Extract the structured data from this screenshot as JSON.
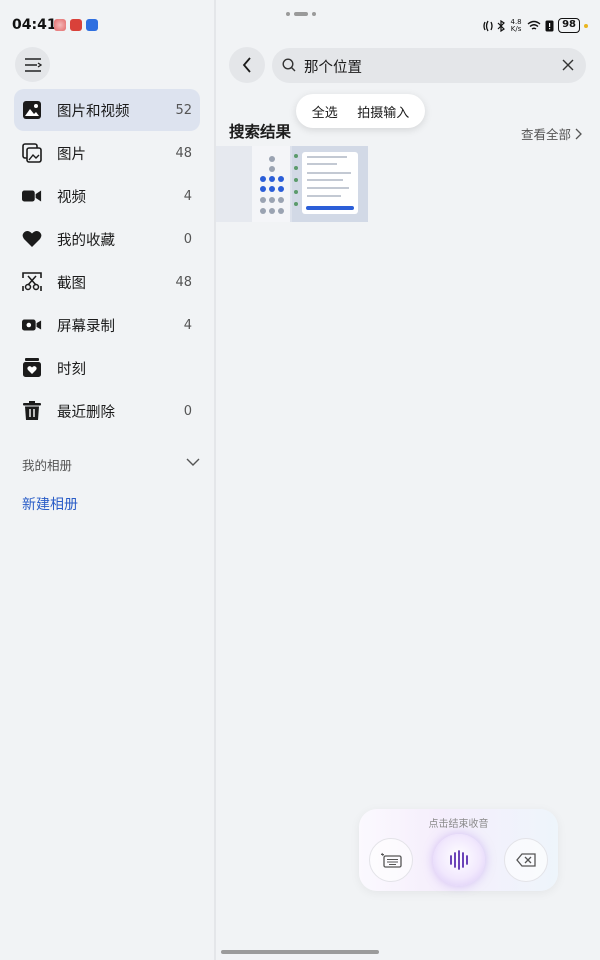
{
  "status_bar": {
    "time": "04:41",
    "network_speed": "4.8\nK/s",
    "battery": "98",
    "icons": [
      "nfc-icon",
      "bluetooth-icon",
      "network-speed-icon",
      "wifi-icon",
      "alert-icon",
      "battery-icon"
    ]
  },
  "sidebar": {
    "items": [
      {
        "label": "图片和视频",
        "count": "52",
        "icon": "photo-video-icon",
        "active": true
      },
      {
        "label": "图片",
        "count": "48",
        "icon": "images-icon"
      },
      {
        "label": "视频",
        "count": "4",
        "icon": "video-icon"
      },
      {
        "label": "我的收藏",
        "count": "0",
        "icon": "heart-icon"
      },
      {
        "label": "截图",
        "count": "48",
        "icon": "screenshot-icon"
      },
      {
        "label": "屏幕录制",
        "count": "4",
        "icon": "screen-record-icon"
      },
      {
        "label": "时刻",
        "count": "",
        "icon": "moments-icon"
      },
      {
        "label": "最近删除",
        "count": "0",
        "icon": "trash-icon"
      }
    ],
    "albums_header": "我的相册",
    "new_album": "新建相册"
  },
  "search": {
    "query": "那个位置"
  },
  "popup": {
    "select_all": "全选",
    "camera_input": "拍摄输入"
  },
  "results": {
    "title": "搜索结果",
    "view_all": "查看全部"
  },
  "voice": {
    "hint": "点击结束收音"
  },
  "colors": {
    "accent": "#2a5dc7",
    "active_item_bg": "#dde3ef",
    "background": "#f1f3f5"
  }
}
